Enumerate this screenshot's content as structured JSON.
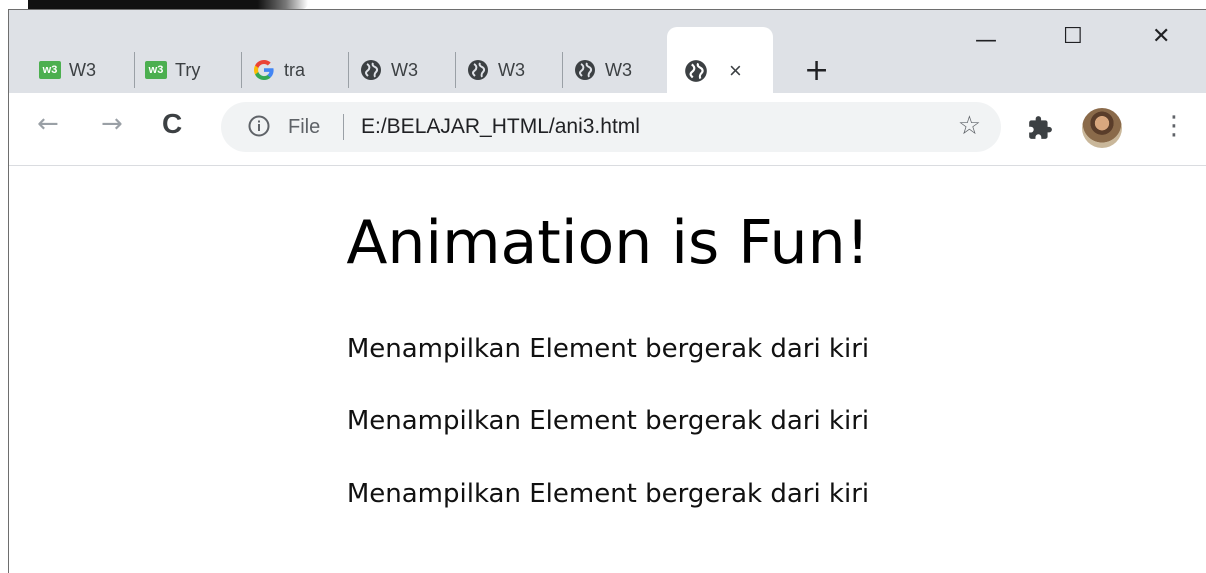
{
  "browser": {
    "tabs": [
      {
        "title": "W3",
        "favicon": "w3schools-icon"
      },
      {
        "title": "Try",
        "favicon": "w3schools-icon"
      },
      {
        "title": "tra",
        "favicon": "google-icon"
      },
      {
        "title": "W3",
        "favicon": "globe-icon"
      },
      {
        "title": "W3",
        "favicon": "globe-icon"
      },
      {
        "title": "W3",
        "favicon": "globe-icon"
      }
    ],
    "active_tab": {
      "favicon": "globe-icon",
      "close": "×"
    },
    "new_tab": "+",
    "window_controls": {
      "minimize": "—",
      "maximize": "☐",
      "close": "✕"
    }
  },
  "toolbar": {
    "back": "←",
    "forward": "→",
    "reload": "C",
    "scheme_label": "File",
    "url": "E:/BELAJAR_HTML/ani3.html",
    "bookmark": "☆",
    "menu": "⋮"
  },
  "page": {
    "heading": "Animation is Fun!",
    "paragraphs": [
      "Menampilkan Element bergerak dari kiri",
      "Menampilkan Element bergerak dari kiri",
      "Menampilkan Element bergerak dari kiri"
    ]
  },
  "colors": {
    "tabstrip_bg": "#dee1e6",
    "omnibox_bg": "#f1f3f4",
    "w3_green": "#4caf50"
  }
}
